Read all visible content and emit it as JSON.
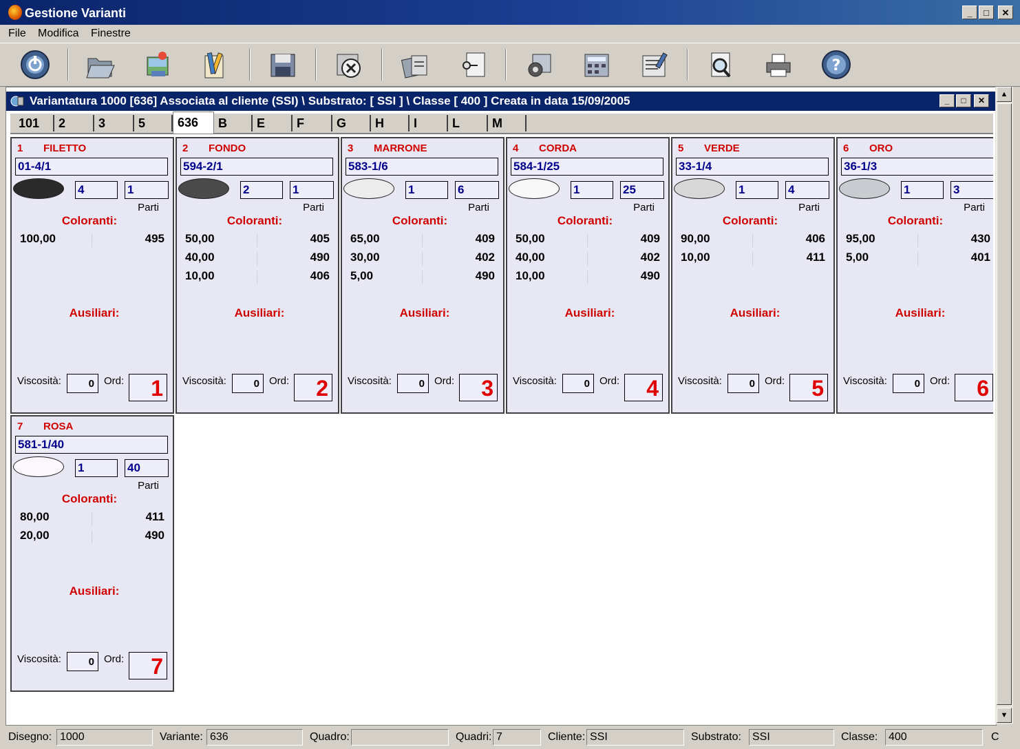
{
  "window": {
    "title": "Gestione Varianti"
  },
  "menu": [
    "File",
    "Modifica",
    "Finestre"
  ],
  "toolbar": [
    "power-icon",
    "open-folder-icon",
    "image-edit-icon",
    "edit-pencil-icon",
    "save-disk-icon",
    "delete-icon",
    "copy-documents-icon",
    "document-link-icon",
    "settings-tools-icon",
    "calculator-icon",
    "report-icon",
    "preview-magnifier-icon",
    "printer-icon",
    "help-icon"
  ],
  "child": {
    "title": "Variantatura 1000 [636] Associata al cliente (SSI) \\ Substrato: [ SSI ] \\ Classe [ 400 ] Creata in data 15/09/2005"
  },
  "tabs": [
    "101",
    "2",
    "3",
    "5",
    "636",
    "B",
    "E",
    "F",
    "G",
    "H",
    "I",
    "L",
    "M"
  ],
  "active_tab": "636",
  "panel_labels": {
    "parti": "Parti",
    "coloranti": "Coloranti:",
    "ausiliari": "Ausiliari:",
    "viscosita": "Viscosità:",
    "ord": "Ord:"
  },
  "panels": [
    {
      "num": "1",
      "name": "FILETTO",
      "code": "01-4/1",
      "swatch": "#2a2a2a",
      "a": "4",
      "b": "1",
      "rows": [
        {
          "pct": "100,00",
          "code": "495"
        }
      ],
      "visc": "0",
      "ord": "1"
    },
    {
      "num": "2",
      "name": "FONDO",
      "code": "594-2/1",
      "swatch": "#4a4a4a",
      "a": "2",
      "b": "1",
      "rows": [
        {
          "pct": "50,00",
          "code": "405"
        },
        {
          "pct": "40,00",
          "code": "490"
        },
        {
          "pct": "10,00",
          "code": "406"
        }
      ],
      "visc": "0",
      "ord": "2"
    },
    {
      "num": "3",
      "name": "MARRONE",
      "code": "583-1/6",
      "swatch": "#ececec",
      "a": "1",
      "b": "6",
      "rows": [
        {
          "pct": "65,00",
          "code": "409"
        },
        {
          "pct": "30,00",
          "code": "402"
        },
        {
          "pct": "5,00",
          "code": "490"
        }
      ],
      "visc": "0",
      "ord": "3"
    },
    {
      "num": "4",
      "name": "CORDA",
      "code": "584-1/25",
      "swatch": "#f8f8f8",
      "a": "1",
      "b": "25",
      "rows": [
        {
          "pct": "50,00",
          "code": "409"
        },
        {
          "pct": "40,00",
          "code": "402"
        },
        {
          "pct": "10,00",
          "code": "490"
        }
      ],
      "visc": "0",
      "ord": "4"
    },
    {
      "num": "5",
      "name": "VERDE",
      "code": "33-1/4",
      "swatch": "#d8d8d8",
      "a": "1",
      "b": "4",
      "rows": [
        {
          "pct": "90,00",
          "code": "406"
        },
        {
          "pct": "10,00",
          "code": "411"
        }
      ],
      "visc": "0",
      "ord": "5"
    },
    {
      "num": "6",
      "name": "ORO",
      "code": "36-1/3",
      "swatch": "#c8ccd0",
      "a": "1",
      "b": "3",
      "rows": [
        {
          "pct": "95,00",
          "code": "430"
        },
        {
          "pct": "5,00",
          "code": "401"
        }
      ],
      "visc": "0",
      "ord": "6"
    },
    {
      "num": "7",
      "name": "ROSA",
      "code": "581-1/40",
      "swatch": "#fbf7fc",
      "a": "1",
      "b": "40",
      "rows": [
        {
          "pct": "80,00",
          "code": "411"
        },
        {
          "pct": "20,00",
          "code": "490"
        }
      ],
      "visc": "0",
      "ord": "7"
    }
  ],
  "status": {
    "disegno_label": "Disegno:",
    "disegno": "1000",
    "variante_label": "Variante:",
    "variante": "636",
    "quadro_label": "Quadro:",
    "quadro": "",
    "quadri_label": "Quadri:",
    "quadri": "7",
    "cliente_label": "Cliente:",
    "cliente": "SSI",
    "substrato_label": "Substrato:",
    "substrato": "SSI",
    "classe_label": "Classe:",
    "classe": "400",
    "extra": "C"
  }
}
